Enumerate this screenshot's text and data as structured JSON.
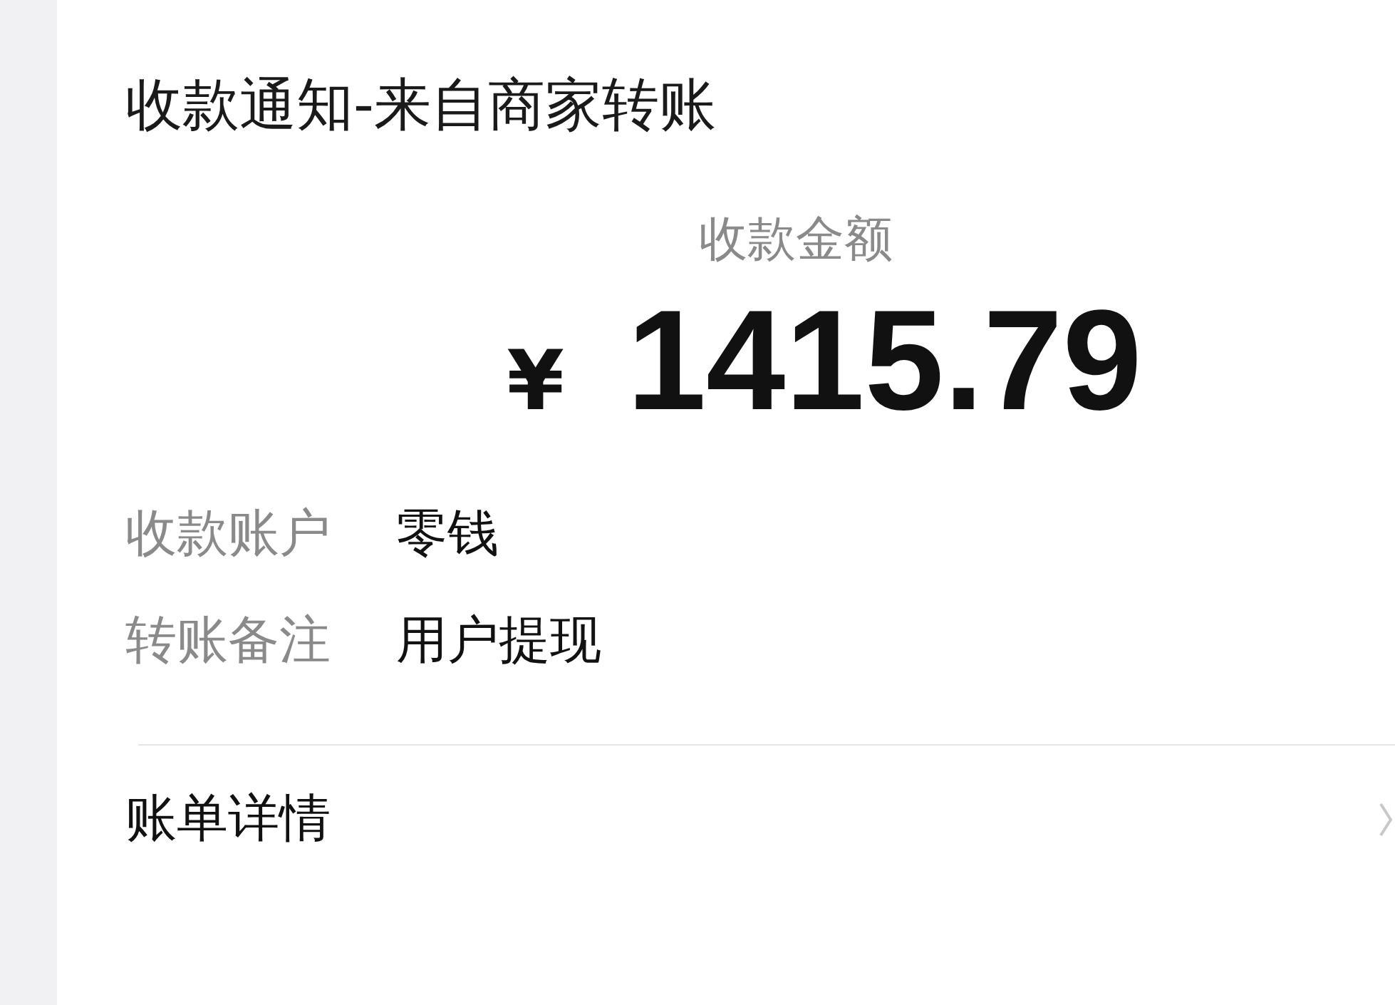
{
  "title": "收款通知-来自商家转账",
  "amount_label": "收款金额",
  "currency": "¥",
  "amount": "1415.79",
  "fields": [
    {
      "label": "收款账户",
      "value": "零钱"
    },
    {
      "label": "转账备注",
      "value": "用户提现"
    }
  ],
  "details_link": "账单详情"
}
